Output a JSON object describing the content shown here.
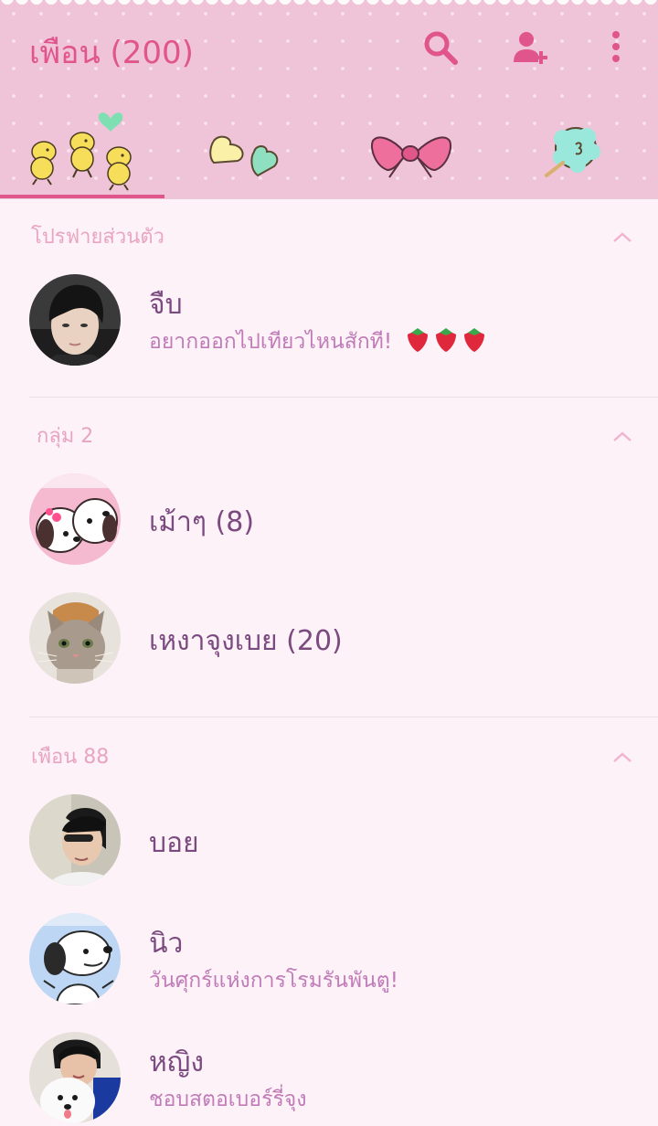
{
  "header": {
    "title": "เพือน (200)",
    "icons": [
      "search-icon",
      "add-friend-icon",
      "more-vert-icon"
    ],
    "accent_color": "#e0558c",
    "tabs": [
      {
        "name": "woodstock-tab",
        "selected": true
      },
      {
        "name": "candy-hearts-tab",
        "selected": false
      },
      {
        "name": "ribbon-tab",
        "selected": false
      },
      {
        "name": "cotton-candy-tab",
        "selected": false
      }
    ]
  },
  "profile_section": {
    "label": "โปรฟายส่วนตัว",
    "user": {
      "name": "จืบ",
      "status": "อยากออกไปเทียวไหนสักที!",
      "emoji": "strawberry x3"
    }
  },
  "group_section": {
    "label": "กลุ่ม 2",
    "groups": [
      {
        "name": "เม้าๆ (8)"
      },
      {
        "name": "เหงาจุงเบย (20)"
      }
    ]
  },
  "friend_section": {
    "label": "เพือน 88",
    "friends": [
      {
        "name": "บอย",
        "status": ""
      },
      {
        "name": "นิว",
        "status": "วันศุกร์แห่งการโรมรันพันตู!"
      },
      {
        "name": "หญิง",
        "status": "ชอบสตอเบอร์รี่จุง"
      }
    ]
  }
}
